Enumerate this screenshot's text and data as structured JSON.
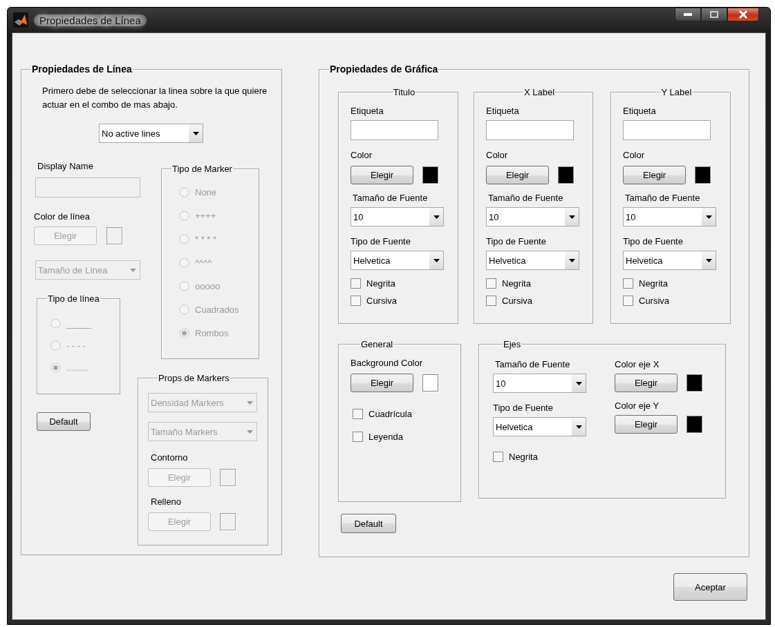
{
  "window": {
    "title": "Propiedades de Línea"
  },
  "line_panel": {
    "title": "Propiedades de Línea",
    "enabled": false,
    "instructions": "Primero debe de seleccionar la linea sobre la que quiere actuar en el combo de mas abajo.",
    "line_select": "No active lines",
    "display_name_label": "Display Name",
    "line_color_label": "Color de línea",
    "line_color_button": "Elegir",
    "line_size_select": "Tamaño de Línea",
    "line_type": {
      "title": "Tipo de línea",
      "options": [
        {
          "label": "_____",
          "selected": false
        },
        {
          "label": "- - - -",
          "selected": false
        },
        {
          "label": ".........",
          "selected": true
        }
      ]
    },
    "default_button": "Default",
    "marker_type": {
      "title": "Tipo de Marker",
      "options": [
        {
          "label": "None",
          "selected": false
        },
        {
          "label": "++++",
          "selected": false
        },
        {
          "label": "* * * *",
          "selected": false
        },
        {
          "label": "^^^^",
          "selected": false
        },
        {
          "label": "ooooo",
          "selected": false
        },
        {
          "label": "Cuadrados",
          "selected": false
        },
        {
          "label": "Rombos",
          "selected": true
        }
      ]
    },
    "marker_props": {
      "title": "Props de Markers",
      "density_select": "Densidad Markers",
      "size_select": "Tamaño Markers",
      "outline_label": "Contorno",
      "outline_button": "Elegir",
      "fill_label": "Relleno",
      "fill_button": "Elegir"
    }
  },
  "graph_panel": {
    "title": "Propiedades de Gráfica",
    "text_groups": [
      {
        "title": "Titulo",
        "label_caption": "Etiqueta",
        "color_caption": "Color",
        "color_button": "Elegir",
        "color": "#000000",
        "size_caption": "Tamaño de Fuente",
        "size": "10",
        "font_caption": "Tipo de Fuente",
        "font": "Helvetica",
        "checks": [
          {
            "label": "Negrita",
            "checked": false
          },
          {
            "label": "Cursiva",
            "checked": false
          }
        ]
      },
      {
        "title": "X Label",
        "label_caption": "Etiqueta",
        "color_caption": "Color",
        "color_button": "Elegir",
        "color": "#000000",
        "size_caption": "Tamaño de Fuente",
        "size": "10",
        "font_caption": "Tipo de Fuente",
        "font": "Helvetica",
        "checks": [
          {
            "label": "Negrita",
            "checked": false
          },
          {
            "label": "Cursiva",
            "checked": false
          }
        ]
      },
      {
        "title": "Y Label",
        "label_caption": "Etiqueta",
        "color_caption": "Color",
        "color_button": "Elegir",
        "color": "#000000",
        "size_caption": "Tamaño de Fuente",
        "size": "10",
        "font_caption": "Tipo de Fuente",
        "font": "Helvetica",
        "checks": [
          {
            "label": "Negrita",
            "checked": false
          },
          {
            "label": "Cursiva",
            "checked": false
          }
        ]
      }
    ],
    "general": {
      "title": "General",
      "bg_caption": "Background Color",
      "bg_button": "Elegir",
      "color": "#ffffff",
      "checks": [
        {
          "label": "Cuadrícula",
          "checked": false
        },
        {
          "label": "Leyenda",
          "checked": false
        }
      ]
    },
    "axes": {
      "title": "Ejes",
      "size_caption": "Tamaño de Fuente",
      "size": "10",
      "font_caption": "Tipo de Fuente",
      "font": "Helvetica",
      "checks": [
        {
          "label": "Negrita",
          "checked": false
        }
      ],
      "axis_colors": [
        {
          "label": "Color eje X",
          "button": "Elegir",
          "color": "#000000"
        },
        {
          "label": "Color eje Y",
          "button": "Elegir",
          "color": "#000000"
        }
      ]
    },
    "default_button": "Default"
  },
  "accept_button": "Aceptar"
}
